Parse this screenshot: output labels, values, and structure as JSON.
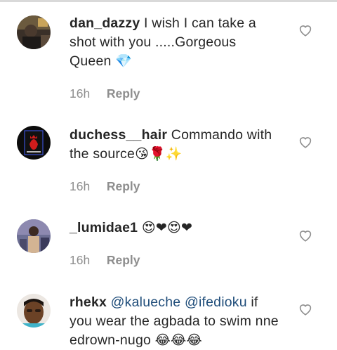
{
  "colors": {
    "text": "#262626",
    "muted": "#8e8e8e",
    "mention": "#1f4d7a",
    "heart_outline": "#8e8e8e"
  },
  "comments": [
    {
      "username": "dan_dazzy",
      "text": "I wish I can take a shot with you .....Gorgeous Queen",
      "emoji": "💎",
      "time": "16h",
      "reply_label": "Reply",
      "like_icon": "heart-outline-icon"
    },
    {
      "username": "duchess__hair",
      "text": "Commando with the source",
      "emoji": "😘🌹✨",
      "time": "16h",
      "reply_label": "Reply",
      "like_icon": "heart-outline-icon"
    },
    {
      "username": "_lumidae1",
      "text": "",
      "emoji": "😍❤😍❤",
      "time": "16h",
      "reply_label": "Reply",
      "like_icon": "heart-outline-icon"
    },
    {
      "username": "rhekx",
      "mentions": [
        "@kalueche",
        "@ifedioku"
      ],
      "text": "if you wear the agbada to swim nne edrown-nugo",
      "emoji": "😂😂😂",
      "like_icon": "heart-outline-icon"
    }
  ]
}
